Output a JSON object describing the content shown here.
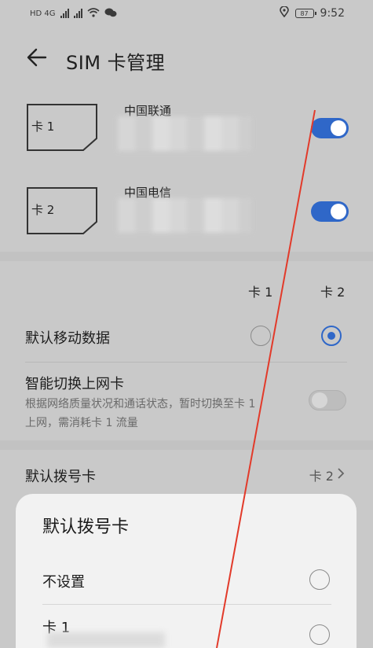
{
  "status_bar": {
    "left_text": "HD 4G",
    "time": "9:52",
    "battery": "87"
  },
  "header": {
    "title": "SIM 卡管理"
  },
  "sims": [
    {
      "card_label": "卡 1",
      "carrier": "中国联通",
      "enabled": true
    },
    {
      "card_label": "卡 2",
      "carrier": "中国电信",
      "enabled": true
    }
  ],
  "columns": {
    "card1": "卡 1",
    "card2": "卡 2"
  },
  "default_data": {
    "label": "默认移动数据",
    "selected": "card2"
  },
  "smart_switch": {
    "label": "智能切换上网卡",
    "description": "根据网络质量状况和通话状态，暂时切换至卡 1 上网，需消耗卡 1 流量",
    "enabled": false
  },
  "default_dial": {
    "label": "默认拨号卡",
    "value": "卡 2"
  },
  "dialog": {
    "title": "默认拨号卡",
    "options": [
      {
        "label": "不设置"
      },
      {
        "label": "卡 1"
      }
    ]
  },
  "colors": {
    "accent": "#2f67c8",
    "annotation_line": "#e23a2a"
  }
}
